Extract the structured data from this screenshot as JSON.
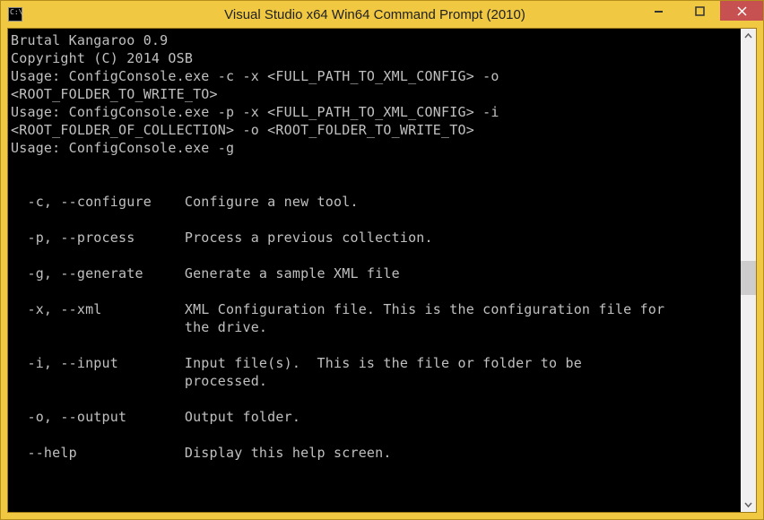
{
  "window": {
    "title": "Visual Studio x64 Win64 Command Prompt (2010)",
    "icon_label": "C:\\"
  },
  "console": {
    "lines": [
      "Brutal Kangaroo 0.9",
      "Copyright (C) 2014 OSB",
      "Usage: ConfigConsole.exe -c -x <FULL_PATH_TO_XML_CONFIG> -o",
      "<ROOT_FOLDER_TO_WRITE_TO>",
      "Usage: ConfigConsole.exe -p -x <FULL_PATH_TO_XML_CONFIG> -i",
      "<ROOT_FOLDER_OF_COLLECTION> -o <ROOT_FOLDER_TO_WRITE_TO>",
      "Usage: ConfigConsole.exe -g",
      "",
      "",
      "  -c, --configure    Configure a new tool.",
      "",
      "  -p, --process      Process a previous collection.",
      "",
      "  -g, --generate     Generate a sample XML file",
      "",
      "  -x, --xml          XML Configuration file. This is the configuration file for",
      "                     the drive.",
      "",
      "  -i, --input        Input file(s).  This is the file or folder to be",
      "                     processed.",
      "",
      "  -o, --output       Output folder.",
      "",
      "  --help             Display this help screen.",
      ""
    ]
  }
}
